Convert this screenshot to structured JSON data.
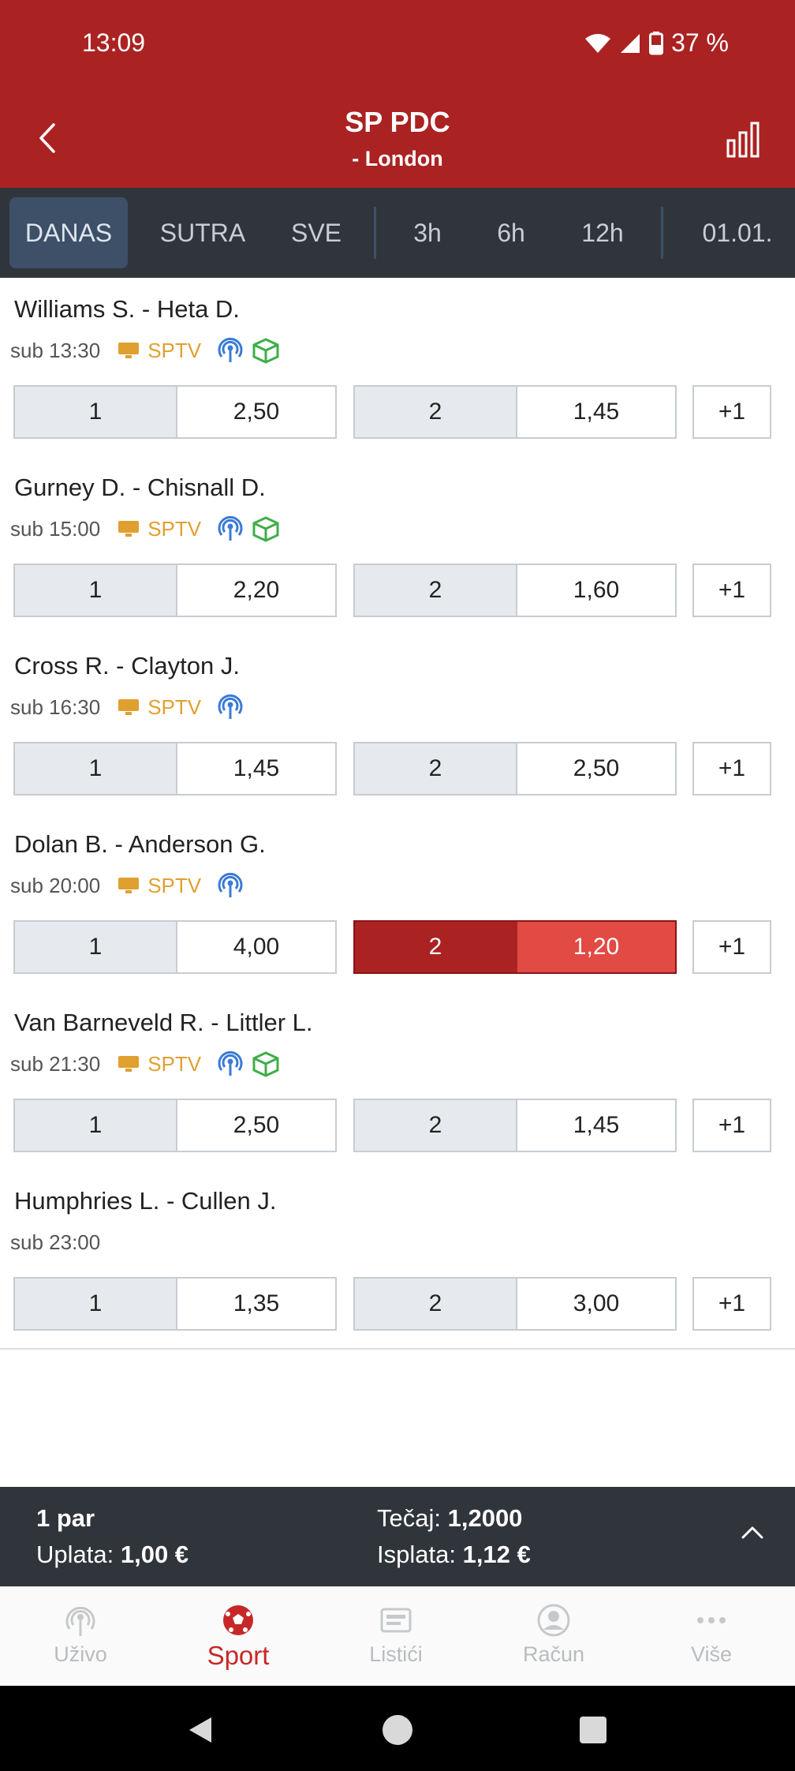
{
  "status_bar": {
    "time": "13:09",
    "battery": "37 %"
  },
  "header": {
    "title": "SP PDC",
    "subtitle": "- London"
  },
  "tabs": [
    {
      "label": "DANAS",
      "active": true
    },
    {
      "label": "SUTRA"
    },
    {
      "label": "SVE"
    },
    {
      "label": "3h"
    },
    {
      "label": "6h"
    },
    {
      "label": "12h"
    },
    {
      "label": "01.01."
    }
  ],
  "events": [
    {
      "name": "Williams S. - Heta D.",
      "time": "sub 13:30",
      "tv": "SPTV",
      "home_label": "1",
      "home_odd": "2,50",
      "away_label": "2",
      "away_odd": "1,45",
      "more": "+1"
    },
    {
      "name": "Gurney D. - Chisnall D.",
      "time": "sub 15:00",
      "tv": "SPTV",
      "home_label": "1",
      "home_odd": "2,20",
      "away_label": "2",
      "away_odd": "1,60",
      "more": "+1"
    },
    {
      "name": "Cross R. - Clayton J.",
      "time": "sub 16:30",
      "tv": "SPTV",
      "home_label": "1",
      "home_odd": "1,45",
      "away_label": "2",
      "away_odd": "2,50",
      "more": "+1"
    },
    {
      "name": "Dolan B. - Anderson G.",
      "time": "sub 20:00",
      "tv": "SPTV",
      "home_label": "1",
      "home_odd": "4,00",
      "away_label": "2",
      "away_odd": "1,20",
      "more": "+1",
      "selected": "away"
    },
    {
      "name": "Van Barneveld R. - Littler L.",
      "time": "sub 21:30",
      "tv": "SPTV",
      "home_label": "1",
      "home_odd": "2,50",
      "away_label": "2",
      "away_odd": "1,45",
      "more": "+1"
    },
    {
      "name": "Humphries L. - Cullen J.",
      "time": "sub 23:00",
      "home_label": "1",
      "home_odd": "1,35",
      "away_label": "2",
      "away_odd": "3,00",
      "more": "+1"
    }
  ],
  "betslip": {
    "pairs": "1 par",
    "stake_label": "Uplata:",
    "stake_value": "1,00 €",
    "odds_label": "Tečaj:",
    "odds_value": "1,2000",
    "payout_label": "Isplata:",
    "payout_value": "1,12 €"
  },
  "bottom_nav": [
    {
      "label": "Uživo",
      "icon": "live-icon"
    },
    {
      "label": "Sport",
      "icon": "soccer-ball-icon",
      "active": true
    },
    {
      "label": "Listići",
      "icon": "ticket-icon"
    },
    {
      "label": "Račun",
      "icon": "account-icon"
    },
    {
      "label": "Više",
      "icon": "more-icon"
    }
  ],
  "colors": {
    "brand_red": "#ab2222",
    "selected_odd": "#e24a44",
    "tv_orange": "#e0a030",
    "live_blue": "#3a7bd5",
    "stats_green": "#3fae49",
    "dark_bar": "#2f353b"
  }
}
